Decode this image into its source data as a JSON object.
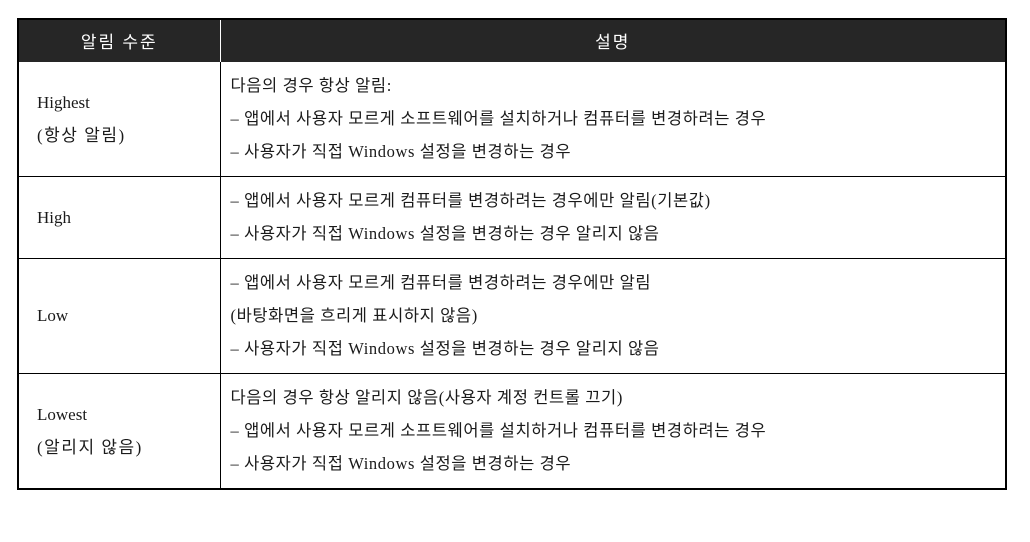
{
  "table": {
    "headers": {
      "level": "알림 수준",
      "description": "설명"
    },
    "rows": [
      {
        "level_name": "Highest",
        "level_sub": "(항상 알림)",
        "description_lines": [
          "다음의 경우 항상 알림:",
          "– 앱에서 사용자 모르게 소프트웨어를 설치하거나 컴퓨터를 변경하려는 경우",
          "– 사용자가 직접 Windows 설정을 변경하는 경우"
        ]
      },
      {
        "level_name": "High",
        "level_sub": "",
        "description_lines": [
          "– 앱에서 사용자 모르게 컴퓨터를 변경하려는 경우에만 알림(기본값)",
          "– 사용자가 직접 Windows 설정을 변경하는 경우 알리지 않음"
        ]
      },
      {
        "level_name": "Low",
        "level_sub": "",
        "description_lines": [
          "– 앱에서 사용자 모르게 컴퓨터를 변경하려는 경우에만 알림",
          "(바탕화면을 흐리게 표시하지 않음)",
          "– 사용자가 직접 Windows 설정을 변경하는 경우 알리지 않음"
        ]
      },
      {
        "level_name": "Lowest",
        "level_sub": "(알리지 않음)",
        "description_lines": [
          "다음의 경우 항상 알리지 않음(사용자 계정 컨트롤 끄기)",
          "– 앱에서 사용자 모르게 소프트웨어를 설치하거나 컴퓨터를 변경하려는 경우",
          "– 사용자가 직접 Windows 설정을 변경하는 경우"
        ]
      }
    ]
  },
  "colors": {
    "header_background": "#262626",
    "header_text": "#ffffff",
    "border": "#000000",
    "body_text": "#1a1a1a",
    "page_background": "#ffffff"
  }
}
